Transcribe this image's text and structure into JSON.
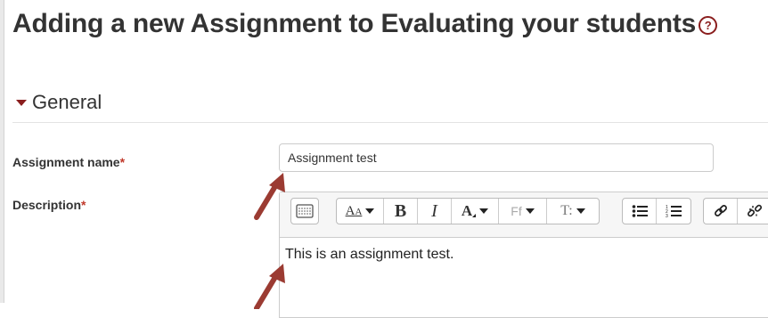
{
  "page": {
    "title": "Adding a new Assignment to Evaluating your students"
  },
  "help": {
    "glyph": "?",
    "icon": "help-question-icon"
  },
  "general": {
    "legend": "General",
    "expanded": true
  },
  "form": {
    "assignment_name": {
      "label": "Assignment name",
      "required_mark": "*",
      "value": "Assignment test"
    },
    "description": {
      "label": "Description",
      "required_mark": "*",
      "content": "This is an assignment test."
    }
  },
  "toolbar": {
    "bold": "B",
    "italic": "I",
    "font_family": "Ff",
    "font_size": "T:",
    "style": "A",
    "color": "A"
  },
  "colors": {
    "accent": "#8a1e1e",
    "annotation_arrow": "#9b3b32",
    "required": "#c0392b"
  }
}
